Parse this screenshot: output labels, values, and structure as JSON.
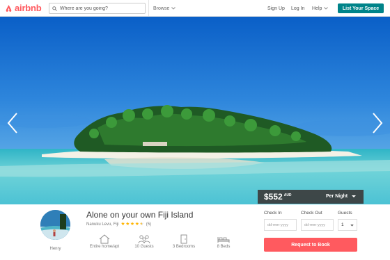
{
  "brand": {
    "name": "airbnb",
    "color": "#ff5a5f"
  },
  "search": {
    "placeholder": "Where are you going?"
  },
  "nav": {
    "browse": "Browse",
    "signup": "Sign Up",
    "login": "Log In",
    "help": "Help",
    "list_space": "List Your Space"
  },
  "hero": {
    "prev_icon": "chevron-left-icon",
    "next_icon": "chevron-right-icon"
  },
  "pricing": {
    "amount": "$552",
    "currency": "AUD",
    "period": "Per Night"
  },
  "listing": {
    "title": "Alone on your own Fiji Island",
    "location": "Nanuku Levu, Fiji",
    "rating": 4.5,
    "review_count": "(5)",
    "host_name": "Henry",
    "features": [
      {
        "label": "Entire home/apt",
        "icon": "home-icon"
      },
      {
        "label": "10 Guests",
        "icon": "guests-icon"
      },
      {
        "label": "3 Bedrooms",
        "icon": "door-icon"
      },
      {
        "label": "8 Beds",
        "icon": "bed-icon"
      }
    ]
  },
  "booking": {
    "checkin_label": "Check In",
    "checkout_label": "Check Out",
    "guests_label": "Guests",
    "date_placeholder": "dd-mm-yyyy",
    "guests_value": "1",
    "request_label": "Request to Book"
  },
  "colors": {
    "accent": "#ff5a5f",
    "list_button": "#00848a",
    "star": "#ffb400"
  }
}
